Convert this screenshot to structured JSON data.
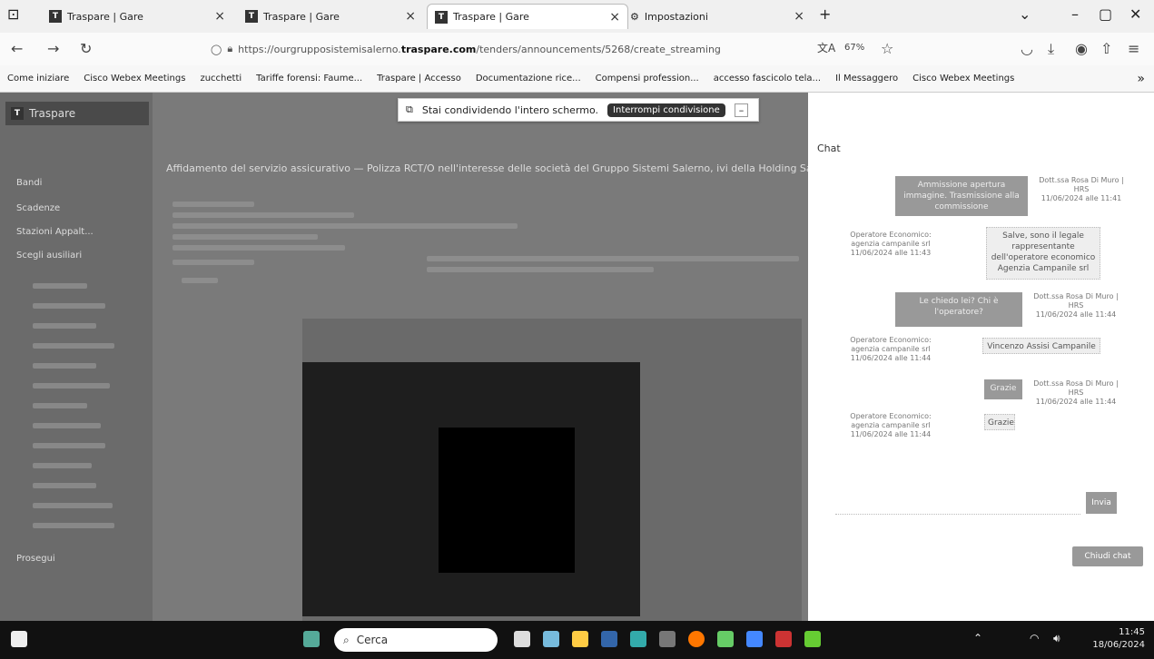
{
  "tabs": [
    {
      "label": "Traspare | Gare"
    },
    {
      "label": "Traspare | Gare"
    },
    {
      "label": "Traspare | Gare"
    },
    {
      "label": "Impostazioni"
    }
  ],
  "address_bar": {
    "url_prefix": "https://ourgrupposistemisalerno.",
    "url_host": "traspare.com",
    "url_path": "/tenders/announcements/5268/create_streaming",
    "zoom": "67%"
  },
  "bookmarks": [
    "Come iniziare",
    "Cisco Webex Meetings",
    "zucchetti",
    "Tariffe forensi: Faume...",
    "Traspare | Accesso",
    "Documentazione rice...",
    "Compensi profession...",
    "accesso fascicolo tela...",
    "Il Messaggero",
    "Cisco Webex Meetings"
  ],
  "sharing_banner": {
    "text": "Stai condividendo l'intero schermo.",
    "stop_label": "Interrompi condivisione"
  },
  "app": {
    "brand": "Traspare",
    "nav": [
      "Bandi",
      "Scadenze",
      "Stazioni Appalt...",
      "Scegli ausiliari"
    ],
    "footer_item": "Prosegui",
    "content_title": "Affidamento del servizio assicurativo — Polizza RCT/O nell'interesse delle società del Gruppo Sistemi Salerno, ivi della Holding Salerno"
  },
  "chat": {
    "title": "Chat",
    "messages": [
      {
        "side": "sent",
        "text": "Ammissione apertura immagine. Trasmissione alla commissione",
        "sender": "Dott.ssa Rosa Di Muro | HRS",
        "time": "11/06/2024 alle 11:41"
      },
      {
        "side": "recv",
        "text": "Salve, sono il legale rappresentante dell'operatore economico Agenzia Campanile srl",
        "sender": "Operatore Economico: agenzia campanile srl",
        "time": "11/06/2024 alle 11:43"
      },
      {
        "side": "sent",
        "text": "Le chiedo lei? Chi è l'operatore?",
        "sender": "Dott.ssa Rosa Di Muro | HRS",
        "time": "11/06/2024 alle 11:44"
      },
      {
        "side": "recv",
        "text": "Vincenzo Assisi Campanile",
        "sender": "Operatore Economico: agenzia campanile srl",
        "time": "11/06/2024 alle 11:44"
      },
      {
        "side": "sent",
        "text": "Grazie",
        "sender": "Dott.ssa Rosa Di Muro | HRS",
        "time": "11/06/2024 alle 11:44"
      },
      {
        "side": "recv",
        "text": "Grazie",
        "sender": "Operatore Economico: agenzia campanile srl",
        "time": "11/06/2024 alle 11:44"
      }
    ],
    "send_label": "Invia",
    "close_label": "Chiudi chat"
  },
  "taskbar": {
    "search_placeholder": "Cerca",
    "time": "11:45",
    "date": "18/06/2024"
  }
}
